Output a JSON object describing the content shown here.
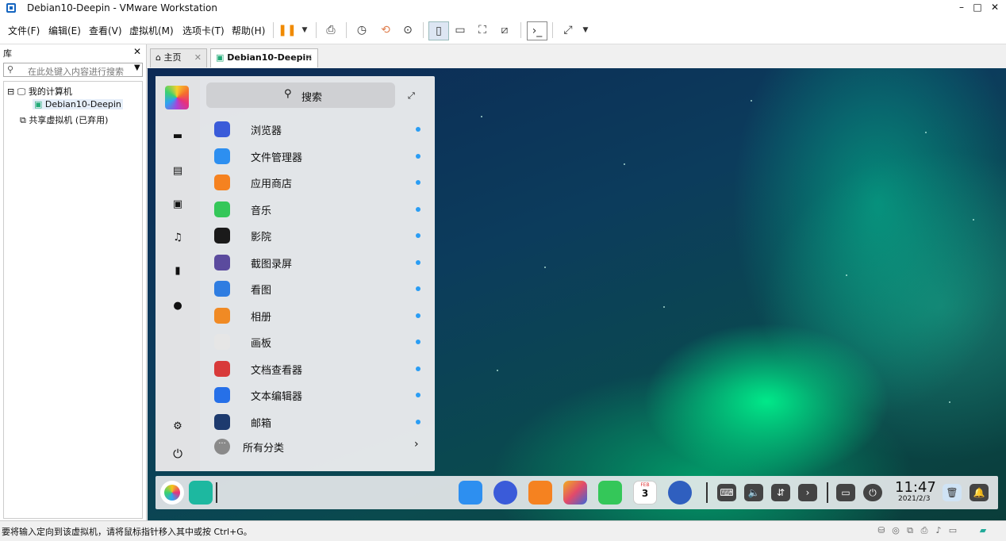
{
  "window": {
    "title": "Debian10-Deepin - VMware Workstation",
    "controls": {
      "minimize": "–",
      "maximize": "□",
      "close": "✕"
    }
  },
  "menu": [
    "文件(F)",
    "编辑(E)",
    "查看(V)",
    "虚拟机(M)",
    "选项卡(T)",
    "帮助(H)"
  ],
  "library": {
    "header": "库",
    "close": "✕",
    "search_placeholder": "在此处键入内容进行搜索",
    "tree": {
      "my_computer": "我的计算机",
      "vm": "Debian10-Deepin",
      "shared": "共享虚拟机 (已弃用)"
    }
  },
  "tabs": [
    {
      "label": "主页",
      "close": "✕"
    },
    {
      "label": "Debian10-Deepin",
      "close": "✕"
    }
  ],
  "launcher": {
    "search_label": "搜索",
    "expand": "⤢",
    "apps": [
      {
        "label": "浏览器",
        "color": "#3a5bd9"
      },
      {
        "label": "文件管理器",
        "color": "#2d8ff0"
      },
      {
        "label": "应用商店",
        "color": "#f58220"
      },
      {
        "label": "音乐",
        "color": "#34c759"
      },
      {
        "label": "影院",
        "color": "#1a1a1a"
      },
      {
        "label": "截图录屏",
        "color": "#5b4b9e"
      },
      {
        "label": "看图",
        "color": "#2f7de1"
      },
      {
        "label": "相册",
        "color": "#f08a24"
      },
      {
        "label": "画板",
        "color": "#e6e6e6"
      },
      {
        "label": "文档查看器",
        "color": "#d83a3a"
      },
      {
        "label": "文本编辑器",
        "color": "#2670e8"
      },
      {
        "label": "邮箱",
        "color": "#1d3a6e"
      }
    ],
    "all_categories": "所有分类",
    "chevron": "›"
  },
  "dock": {
    "time": "11:47",
    "date": "2021/2/3",
    "calendar_month": "FEB",
    "calendar_day": "3"
  },
  "status": {
    "message": "要将输入定向到该虚拟机，请将鼠标指针移入其中或按 Ctrl+G。"
  }
}
